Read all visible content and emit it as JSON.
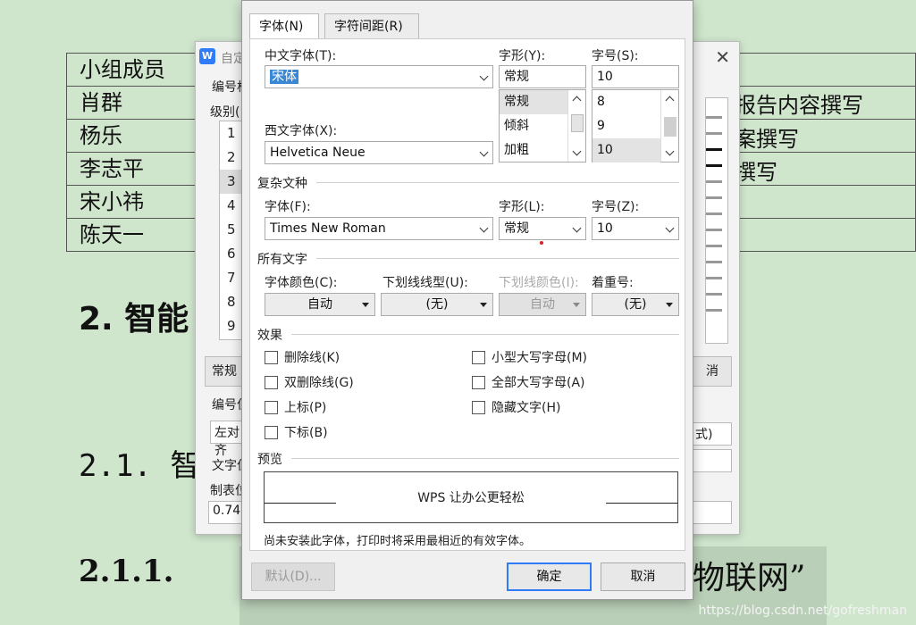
{
  "document": {
    "table_rows": [
      "小组成员",
      "肖群",
      "杨乐",
      "李志平",
      "宋小祎",
      "陈天一"
    ],
    "table_right": [
      "报告内容撰写",
      "案撰写",
      "撰写"
    ],
    "heading_2": "2.  智能",
    "heading_2_1": "2.1.  智",
    "heading_2_1_1": "2.1.1.",
    "heading_2_1_1_right": "物联网”",
    "watermark": "https://blog.csdn.net/gofreshman"
  },
  "back_dialog": {
    "title": "自定",
    "level_labels": [
      "编号格",
      "级别("
    ],
    "levels": [
      "1",
      "2",
      "3",
      "4",
      "5",
      "6",
      "7",
      "8",
      "9"
    ],
    "selected_level": "3",
    "normal_button": "常规",
    "cancel_button": "消",
    "number_position_label": "编号位",
    "align_value": "左对齐",
    "text_position_label": "文字位",
    "tab_label": "制表位",
    "tab_value": "0.74",
    "style_value": "式)"
  },
  "font_dialog": {
    "tabs": [
      "字体(N)",
      "字符间距(R)"
    ],
    "active_tab": "字体(N)",
    "chinese_font": {
      "label": "中文字体(T):",
      "value": "宋体"
    },
    "western_font": {
      "label": "西文字体(X):",
      "value": "Helvetica Neue"
    },
    "style": {
      "label": "字形(Y):",
      "value": "常规",
      "options": [
        "常规",
        "倾斜",
        "加粗"
      ],
      "selected": "常规"
    },
    "size": {
      "label": "字号(S):",
      "value": "10",
      "options": [
        "8",
        "9",
        "10"
      ],
      "selected": "10"
    },
    "complex_section": "复杂文种",
    "complex_font": {
      "label": "字体(F):",
      "value": "Times New Roman"
    },
    "complex_style": {
      "label": "字形(L):",
      "value": "常规"
    },
    "complex_size": {
      "label": "字号(Z):",
      "value": "10"
    },
    "all_text_section": "所有文字",
    "font_color": {
      "label": "字体颜色(C):",
      "value": "自动"
    },
    "underline_type": {
      "label": "下划线线型(U):",
      "value": "(无)"
    },
    "underline_color": {
      "label": "下划线颜色(I):",
      "value": "自动"
    },
    "emphasis": {
      "label": "着重号:",
      "value": "(无)"
    },
    "effects_section": "效果",
    "effects_left": [
      "删除线(K)",
      "双删除线(G)",
      "上标(P)",
      "下标(B)"
    ],
    "effects_right": [
      "小型大写字母(M)",
      "全部大写字母(A)",
      "隐藏文字(H)"
    ],
    "preview_section": "预览",
    "preview_text": "WPS 让办公更轻松",
    "note": "尚未安装此字体，打印时将采用最相近的有效字体。",
    "default_button": "默认(D)...",
    "ok_button": "确定",
    "cancel_button": "取消"
  }
}
